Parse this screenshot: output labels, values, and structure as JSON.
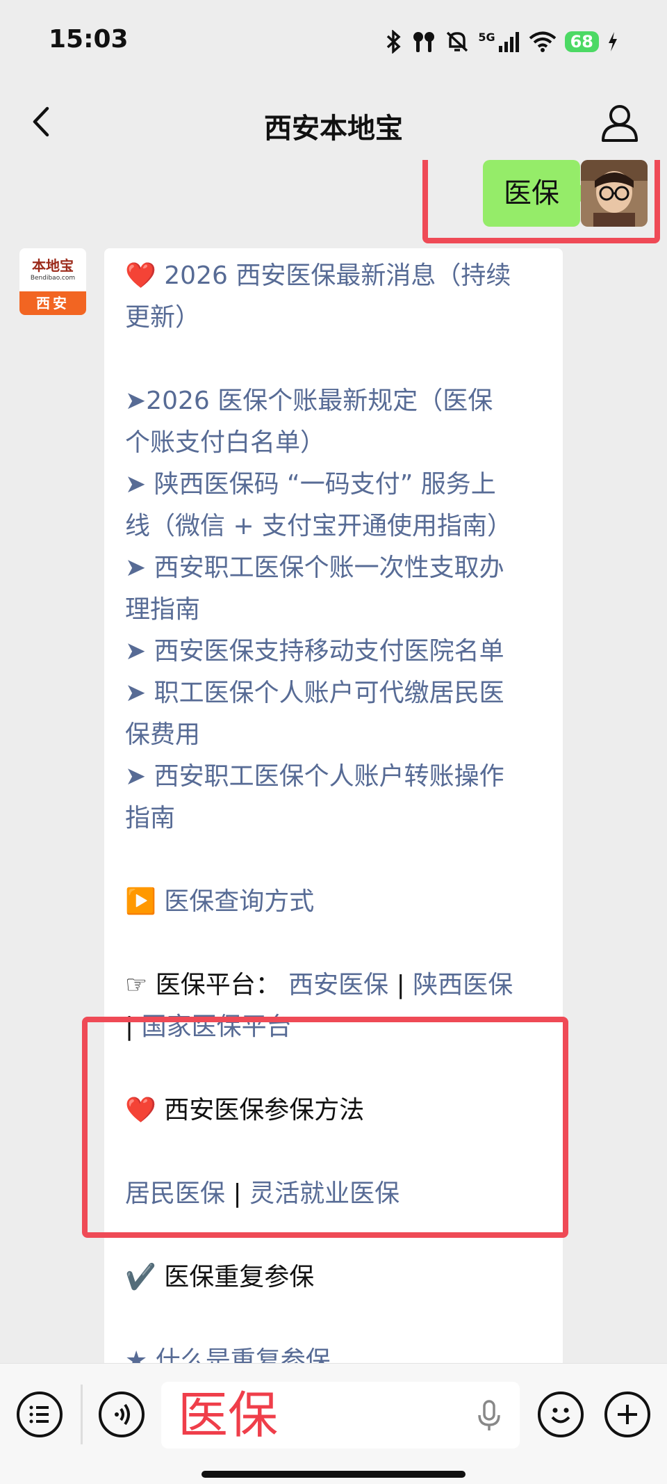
{
  "status_bar": {
    "time": "15:03",
    "network": "5G",
    "battery": "68"
  },
  "nav": {
    "title": "西安本地宝"
  },
  "my_message": {
    "text": "医保"
  },
  "bot_avatar": {
    "logo_cn": "本地宝",
    "logo_en": "Bendibao.com",
    "city": "西安"
  },
  "article": {
    "headline": "❤️ 2026 西安医保最新消息（持续",
    "headline2": "更新）",
    "links": [
      "➤2026 医保个账最新规定（医保",
      "个账支付白名单）",
      "➤ 陕西医保码 “一码支付” 服务上",
      "线（微信 + 支付宝开通使用指南）",
      "➤ 西安职工医保个账一次性支取办",
      "理指南",
      "➤ 西安医保支持移动支付医院名单",
      "➤ 职工医保个人账户可代缴居民医",
      "保费用",
      "➤ 西安职工医保个人账户转账操作",
      "指南"
    ],
    "query_title": "▶️ 医保查询方式",
    "platform_label": "☞ 医保平台：",
    "platform_link1": "西安医保",
    "separator": "|",
    "platform_link2": "陕西医保",
    "platform_link3": "国家医保平台",
    "enroll_title": "❤️ 西安医保参保方法",
    "enroll_link1": "居民医保",
    "enroll_link2": "灵活就业医保",
    "repeat_title": "✔️ 医保重复参保",
    "repeat_link": "★ 什么是重复参保"
  },
  "input": {
    "text": "医保"
  }
}
